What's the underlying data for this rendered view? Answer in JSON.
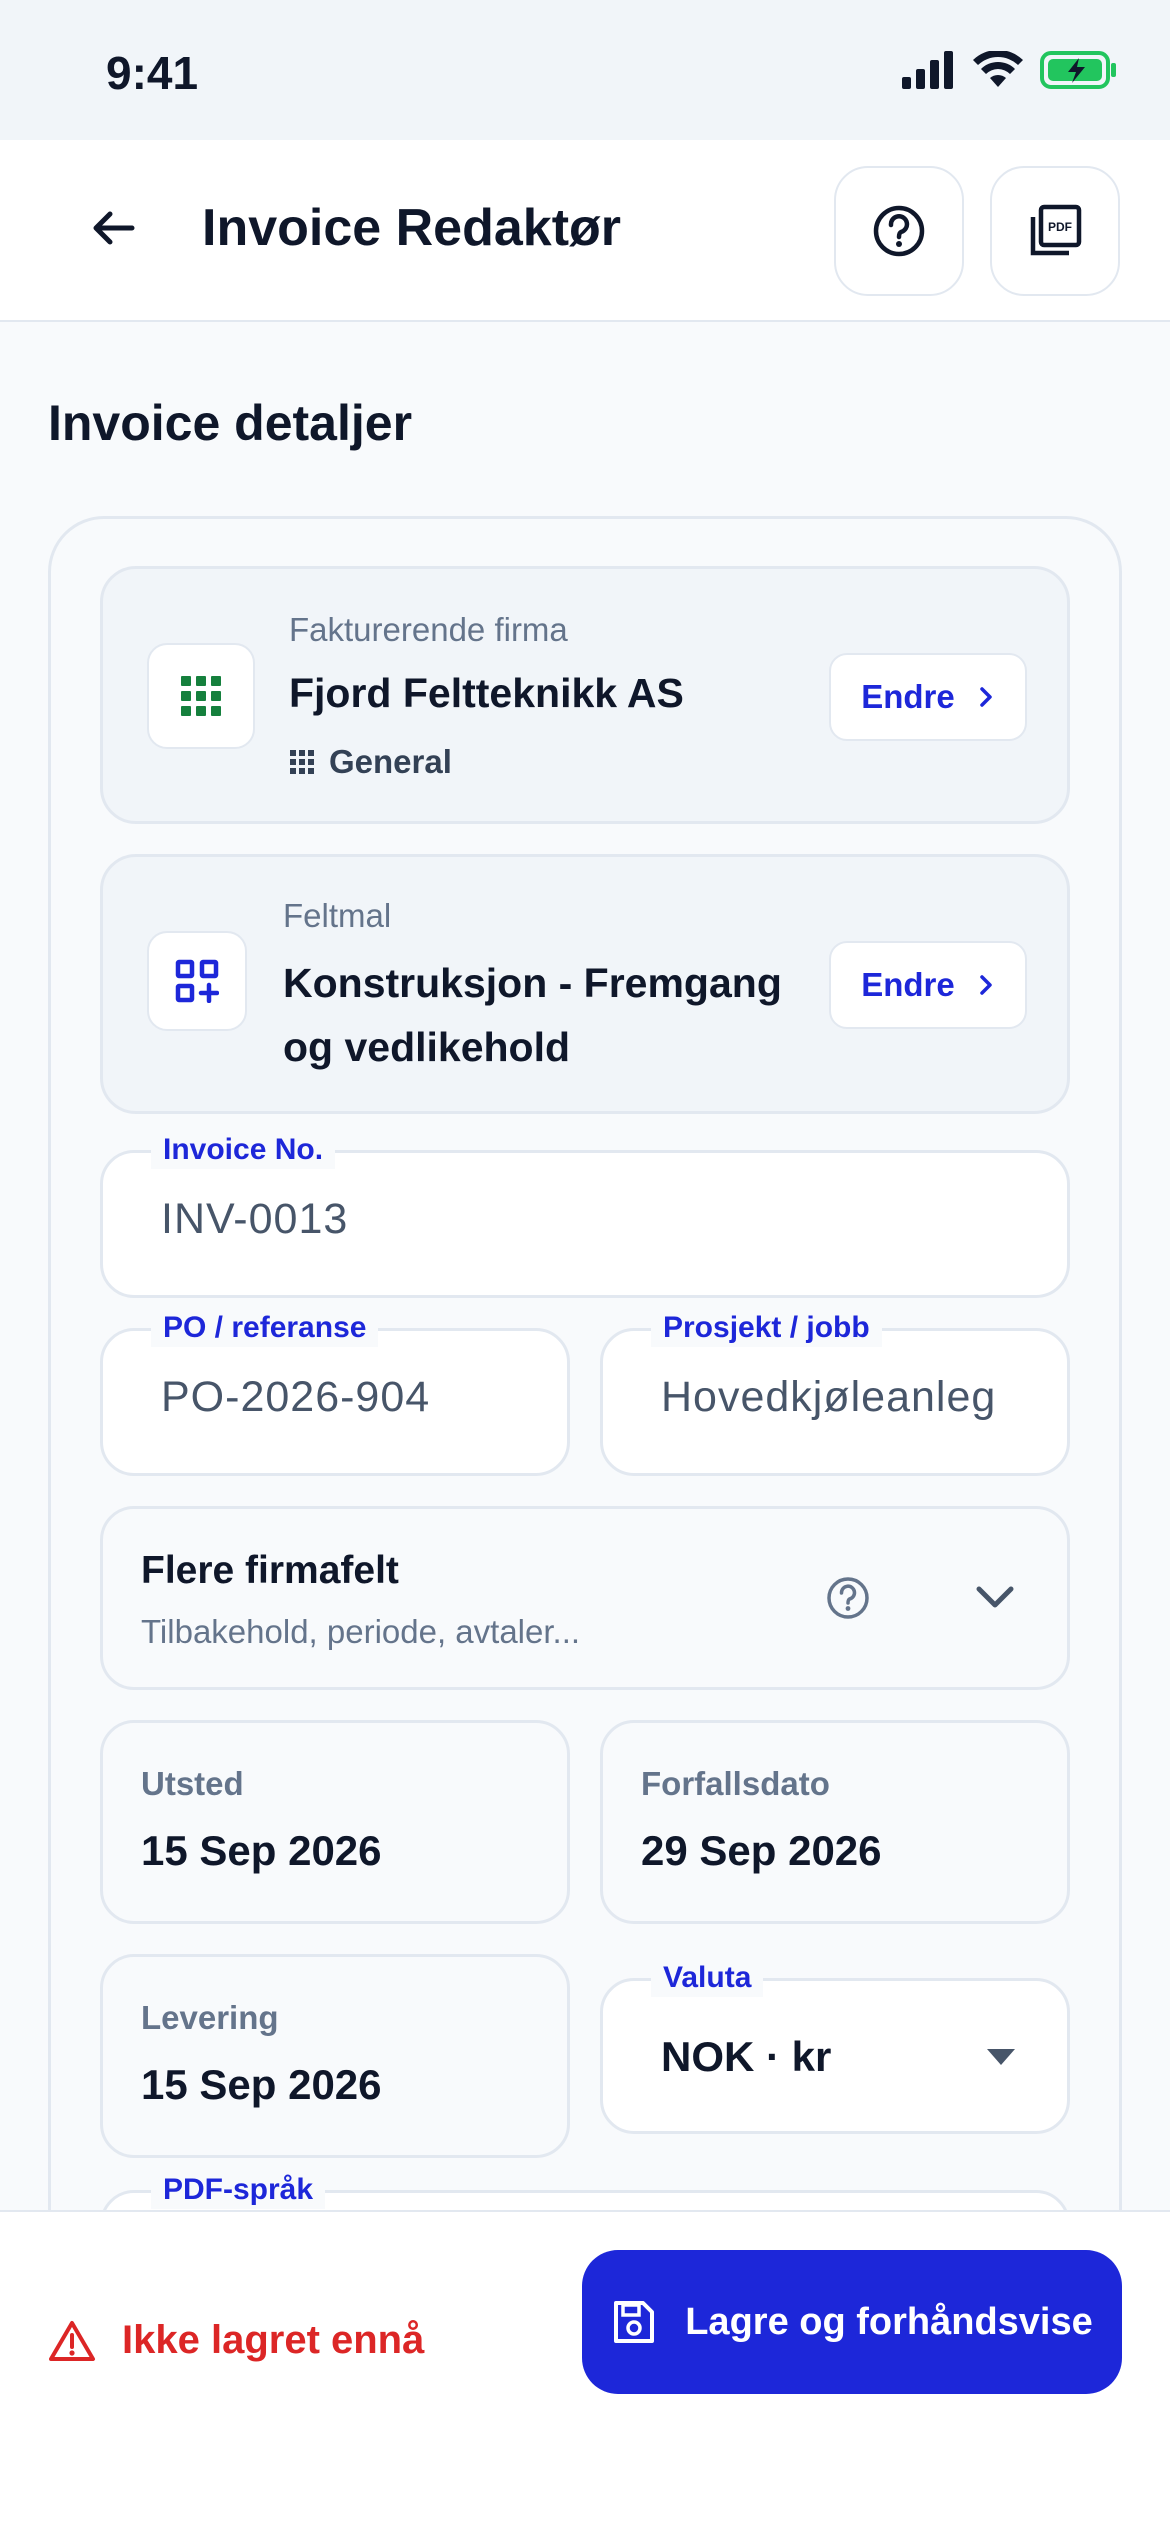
{
  "status_bar": {
    "time": "9:41"
  },
  "app_bar": {
    "title": "Invoice Redaktør"
  },
  "section": {
    "title": "Invoice detaljer"
  },
  "company": {
    "label": "Fakturerende firma",
    "name": "Fjord Feltteknikk AS",
    "category": "General",
    "change_label": "Endre"
  },
  "template": {
    "label": "Feltmal",
    "name_line1": "Konstruksjon - Fremgang",
    "name_line2": "og vedlikehold",
    "change_label": "Endre"
  },
  "invoice_no": {
    "label": "Invoice No.",
    "value": "INV-0013"
  },
  "po_ref": {
    "label": "PO / referanse",
    "value": "PO-2026-904"
  },
  "project": {
    "label": "Prosjekt / jobb",
    "value": "Hovedkjøleanleg"
  },
  "more_fields": {
    "title": "Flere firmafelt",
    "subtitle": "Tilbakehold, periode, avtaler..."
  },
  "issued": {
    "label": "Utsted",
    "value": "15 Sep 2026"
  },
  "due": {
    "label": "Forfallsdato",
    "value": "29 Sep 2026"
  },
  "delivery": {
    "label": "Levering",
    "value": "15 Sep 2026"
  },
  "currency": {
    "label": "Valuta",
    "value": "NOK · kr"
  },
  "pdf_language": {
    "label": "PDF-språk"
  },
  "bottom": {
    "unsaved": "Ikke lagret ennå",
    "save_label": "Lagre og forhåndsvise"
  },
  "colors": {
    "primary": "#1D27D9",
    "danger": "#DC2626",
    "company_icon": "#15803D",
    "battery": "#22C55E"
  }
}
